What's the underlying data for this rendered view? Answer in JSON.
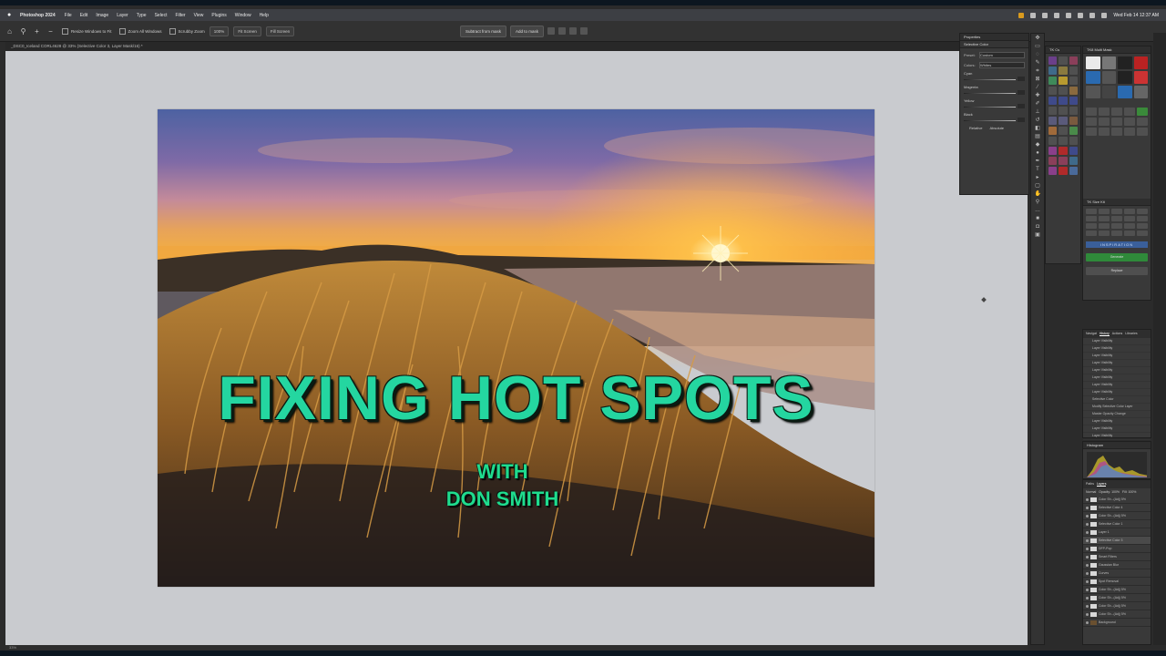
{
  "menubar": {
    "app_name": "Photoshop 2024",
    "items": [
      "File",
      "Edit",
      "Image",
      "Layer",
      "Type",
      "Select",
      "Filter",
      "View",
      "Plugins",
      "Window",
      "Help"
    ],
    "clock": "Wed Feb 14 12:37 AM"
  },
  "options_bar": {
    "resize_windows": "Resize Windows to Fit",
    "zoom_all": "Zoom All Windows",
    "scrubby_zoom": "Scrubby Zoom",
    "zoom_pct": "100%",
    "fit_screen": "Fit Screen",
    "fill_screen": "Fill Screen"
  },
  "mask_bar": {
    "subtract": "Subtract from mask",
    "add": "Add to mask"
  },
  "document": {
    "tab_title": "_DSC0_Iceland CORL4628 @ 33% (Selective Color 3, Layer Mask/16) *",
    "status_zoom": "33%"
  },
  "thumbnail": {
    "title": "FIXING HOT SPOTS",
    "subtitle_line1": "WITH",
    "subtitle_line2": "DON SMITH",
    "title_color": "#24d6a0"
  },
  "properties_panel": {
    "header": "Properties",
    "subheader": "Selective Color",
    "preset_label": "Preset:",
    "preset_value": "Custom",
    "colors_label": "Colors:",
    "colors_value": "Whites",
    "sliders": [
      "Cyan",
      "Magenta",
      "Yellow",
      "Black"
    ],
    "relative": "Relative",
    "absolute": "Absolute"
  },
  "panels": {
    "tk_header": "TK Cs",
    "multimask_header": "TK8 Multi Mask",
    "tk_size_header": "TK Size Kit",
    "inspiration": "INSPIRATION",
    "generate": "Generate",
    "replace": "Replace",
    "history_tabs": [
      "Navigat",
      "History",
      "Actions",
      "Libraries"
    ],
    "history_items": [
      "Layer Visibility",
      "Layer Visibility",
      "Layer Visibility",
      "Layer Visibility",
      "Layer Visibility",
      "Layer Visibility",
      "Layer Visibility",
      "Layer Visibility",
      "Selective Color",
      "Modify Selective Color Layer",
      "Master Opacity Change",
      "Layer Visibility",
      "Layer Visibility",
      "Layer Visibility",
      "Layer Visibility",
      "Layer Visibility"
    ],
    "histogram_header": "Histogram",
    "layers_tabs": [
      "Paths",
      "Layers"
    ],
    "blend_mode": "Normal",
    "opacity": "Opacity: 100%",
    "fill": "Fill: 100%",
    "layers": [
      "Color Sh...(Adj) 5%",
      "Selective Color 4",
      "Color Sh...(Adj) 5%",
      "Selective Color 1",
      "Layer 1",
      "Selective Color 3",
      "DFP-Pop",
      "Smart Filters",
      "Gaussian Blur",
      "Curves",
      "Spot Removal",
      "Color Sh...(Adj) 5%",
      "Color Sh...(Adj) 5%",
      "Color Sh...(Adj) 5%",
      "Color Sh...(Adj) 5%",
      "Background"
    ]
  }
}
